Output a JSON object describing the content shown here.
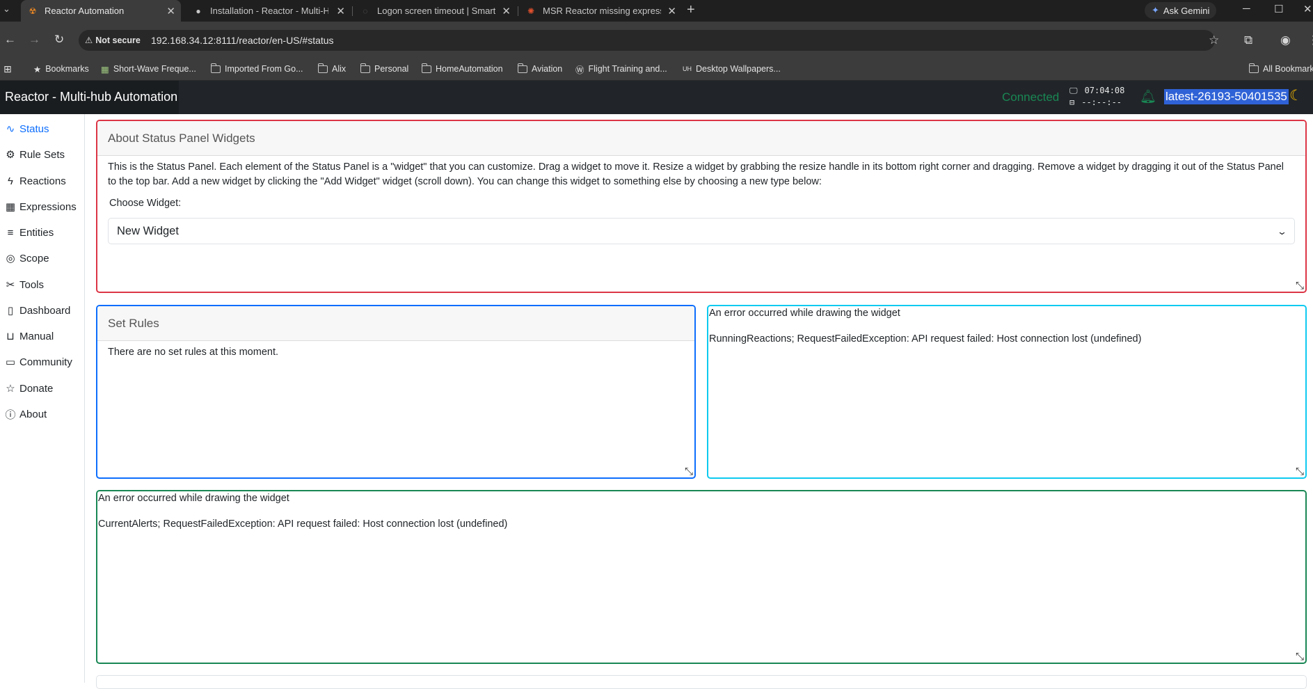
{
  "browser": {
    "tabs": [
      {
        "title": "Reactor Automation",
        "active": true
      },
      {
        "title": "Installation - Reactor - Multi-Hu"
      },
      {
        "title": "Logon screen timeout | Smart H"
      },
      {
        "title": "MSR Reactor missing express m"
      }
    ],
    "ask_gemini": "Ask Gemini",
    "security_label": "Not secure",
    "url": "192.168.34.12:8111/reactor/en-US/#status",
    "bookmarks": [
      "Bookmarks",
      "Short-Wave Freque...",
      "Imported From Go...",
      "Alix",
      "Personal",
      "HomeAutomation",
      "Aviation",
      "Flight Training and...",
      "Desktop Wallpapers...",
      "All Bookmarks"
    ]
  },
  "header": {
    "app_title": "Reactor - Multi-hub Automation",
    "connection_status": "Connected",
    "time": "07:04:08",
    "time2": "--:--:--",
    "build": "latest-26193-50401535"
  },
  "sidebar": {
    "items": [
      {
        "label": "Status",
        "icon": "pulse-icon"
      },
      {
        "label": "Rule Sets",
        "icon": "gear-icon"
      },
      {
        "label": "Reactions",
        "icon": "lightning-icon"
      },
      {
        "label": "Expressions",
        "icon": "calculator-icon"
      },
      {
        "label": "Entities",
        "icon": "list-icon"
      },
      {
        "label": "Scope",
        "icon": "eye-icon"
      },
      {
        "label": "Tools",
        "icon": "tools-icon"
      },
      {
        "label": "Dashboard",
        "icon": "tablet-icon"
      },
      {
        "label": "Manual",
        "icon": "book-icon"
      },
      {
        "label": "Community",
        "icon": "chat-icon"
      },
      {
        "label": "Donate",
        "icon": "star-icon"
      },
      {
        "label": "About",
        "icon": "info-icon"
      }
    ]
  },
  "widgets": {
    "about": {
      "title": "About Status Panel Widgets",
      "text": "This is the Status Panel. Each element of the Status Panel is a \"widget\" that you can customize. Drag a widget to move it. Resize a widget by grabbing the resize handle in its bottom right corner and dragging. Remove a widget by dragging it out of the Status Panel to the top bar. Add a new widget by clicking the \"Add Widget\" widget (scroll down). You can change this widget to something else by choosing a new type below:",
      "choose_label": "Choose Widget:",
      "selected": "New Widget"
    },
    "set_rules": {
      "title": "Set Rules",
      "text": "There are no set rules at this moment."
    },
    "running_reactions": {
      "error_title": "An error occurred while drawing the widget",
      "error_detail": "RunningReactions; RequestFailedException: API request failed: Host connection lost (undefined)"
    },
    "current_alerts": {
      "error_title": "An error occurred while drawing the widget",
      "error_detail": "CurrentAlerts; RequestFailedException: API request failed: Host connection lost (undefined)"
    }
  },
  "colors": {
    "about_border": "#dc3545",
    "set_rules_border": "#0d6efd",
    "reactions_border": "#0dcaf0",
    "alerts_border": "#198754"
  }
}
